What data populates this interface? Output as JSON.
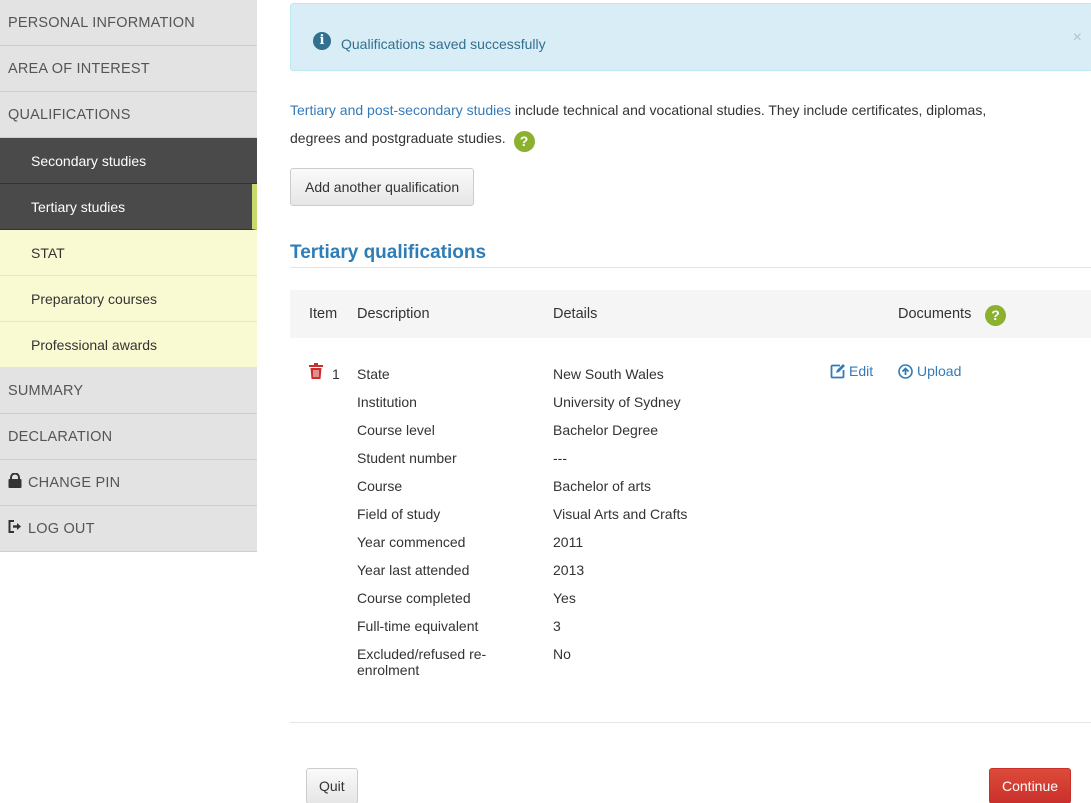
{
  "sidebar": {
    "items": [
      {
        "label": "PERSONAL INFORMATION"
      },
      {
        "label": "AREA OF INTEREST"
      },
      {
        "label": "QUALIFICATIONS"
      },
      {
        "label": "Secondary studies"
      },
      {
        "label": "Tertiary studies"
      },
      {
        "label": "STAT"
      },
      {
        "label": "Preparatory courses"
      },
      {
        "label": "Professional awards"
      },
      {
        "label": "SUMMARY"
      },
      {
        "label": "DECLARATION"
      },
      {
        "label": "CHANGE PIN",
        "icon": "lock-icon"
      },
      {
        "label": "LOG OUT",
        "icon": "logout-icon"
      }
    ]
  },
  "alert": {
    "message": "Qualifications saved successfully",
    "close": "×",
    "icon_glyph": "i"
  },
  "intro": {
    "link_text": "Tertiary and post-secondary studies",
    "text_1": " include technical and vocational studies. They include certificates, diplomas,",
    "text_2": "degrees and postgraduate studies.",
    "help_glyph": "?"
  },
  "buttons": {
    "add_qualification": "Add another qualification",
    "quit": "Quit",
    "continue": "Continue"
  },
  "section": {
    "title": "Tertiary qualifications"
  },
  "table": {
    "headers": {
      "item": "Item",
      "description": "Description",
      "details": "Details",
      "documents": "Documents",
      "help_glyph": "?"
    },
    "row": {
      "item": "1",
      "edit": "Edit",
      "upload": "Upload",
      "fields": [
        {
          "label": "State",
          "value": "New South Wales"
        },
        {
          "label": "Institution",
          "value": "University of Sydney"
        },
        {
          "label": "Course level",
          "value": "Bachelor Degree"
        },
        {
          "label": "Student number",
          "value": "---"
        },
        {
          "label": "Course",
          "value": "Bachelor of arts"
        },
        {
          "label": "Field of study",
          "value": "Visual Arts and Crafts"
        },
        {
          "label": "Year commenced",
          "value": "2011"
        },
        {
          "label": "Year last attended",
          "value": "2013"
        },
        {
          "label": "Course completed",
          "value": "Yes"
        },
        {
          "label": "Full-time equivalent",
          "value": "3"
        },
        {
          "label": "Excluded/refused re-enrolment",
          "value": "No"
        }
      ]
    }
  },
  "colors": {
    "link": "#337ab7",
    "alert_bg": "#d9edf7",
    "help_green": "#8bb12f",
    "danger": "#c9302c",
    "nav_dark": "#4a4a4a",
    "nav_light": "#fafad2"
  }
}
